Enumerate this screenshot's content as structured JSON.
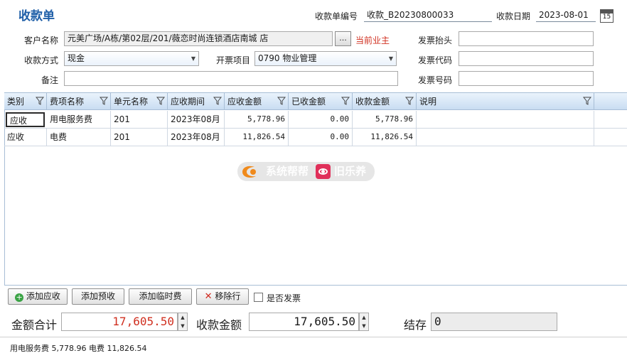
{
  "header": {
    "title": "收款单",
    "receipt_no_label": "收款单编号",
    "receipt_no_value": "收款_B20230800033",
    "date_label": "收款日期",
    "date_value": "2023-08-01",
    "calendar_day": "15"
  },
  "form": {
    "customer_label": "客户名称",
    "customer_value": "元美广场/A栋/第02层/201/薇恋时尚连锁酒店南城  店",
    "browse_label": "...",
    "current_owner_label": "当前业主",
    "payment_method_label": "收款方式",
    "payment_method_value": "现金",
    "invoice_item_label": "开票项目",
    "invoice_item_value": "0790  物业管理",
    "remark_label": "备注",
    "remark_value": "",
    "invoice_title_label": "发票抬头",
    "invoice_title_value": "",
    "invoice_code_label": "发票代码",
    "invoice_code_value": "",
    "invoice_number_label": "发票号码",
    "invoice_number_value": ""
  },
  "grid": {
    "columns": [
      "类别",
      "费项名称",
      "单元名称",
      "应收期间",
      "应收金额",
      "已收金额",
      "收款金额",
      "说明"
    ],
    "rows": [
      {
        "type": "应收",
        "fee_item": "用电服务费",
        "unit": "201",
        "period": "2023年08月",
        "receivable": "5,778.96",
        "received": "0.00",
        "payment": "5,778.96",
        "note": ""
      },
      {
        "type": "应收",
        "fee_item": "电费",
        "unit": "201",
        "period": "2023年08月",
        "receivable": "11,826.54",
        "received": "0.00",
        "payment": "11,826.54",
        "note": ""
      }
    ]
  },
  "watermark": {
    "text_left": "系统帮帮",
    "text_right": "旧乐养"
  },
  "toolbar": {
    "add_receivable": "添加应收",
    "add_prepayment": "添加预收",
    "add_temporary": "添加临时费",
    "remove_row": "移除行",
    "invoice_checkbox": "是否发票"
  },
  "totals": {
    "total_label": "金额合计",
    "total_value": "17,605.50",
    "payment_label": "收款金额",
    "payment_value": "17,605.50",
    "balance_label": "结存",
    "balance_value": "0"
  },
  "status_bar": {
    "text": "用电服务费 5,778.96  电费 11,826.54"
  },
  "colors": {
    "title": "#1f5fa8",
    "alert_red": "#d03020",
    "grid_header": "#c9ddf2"
  }
}
